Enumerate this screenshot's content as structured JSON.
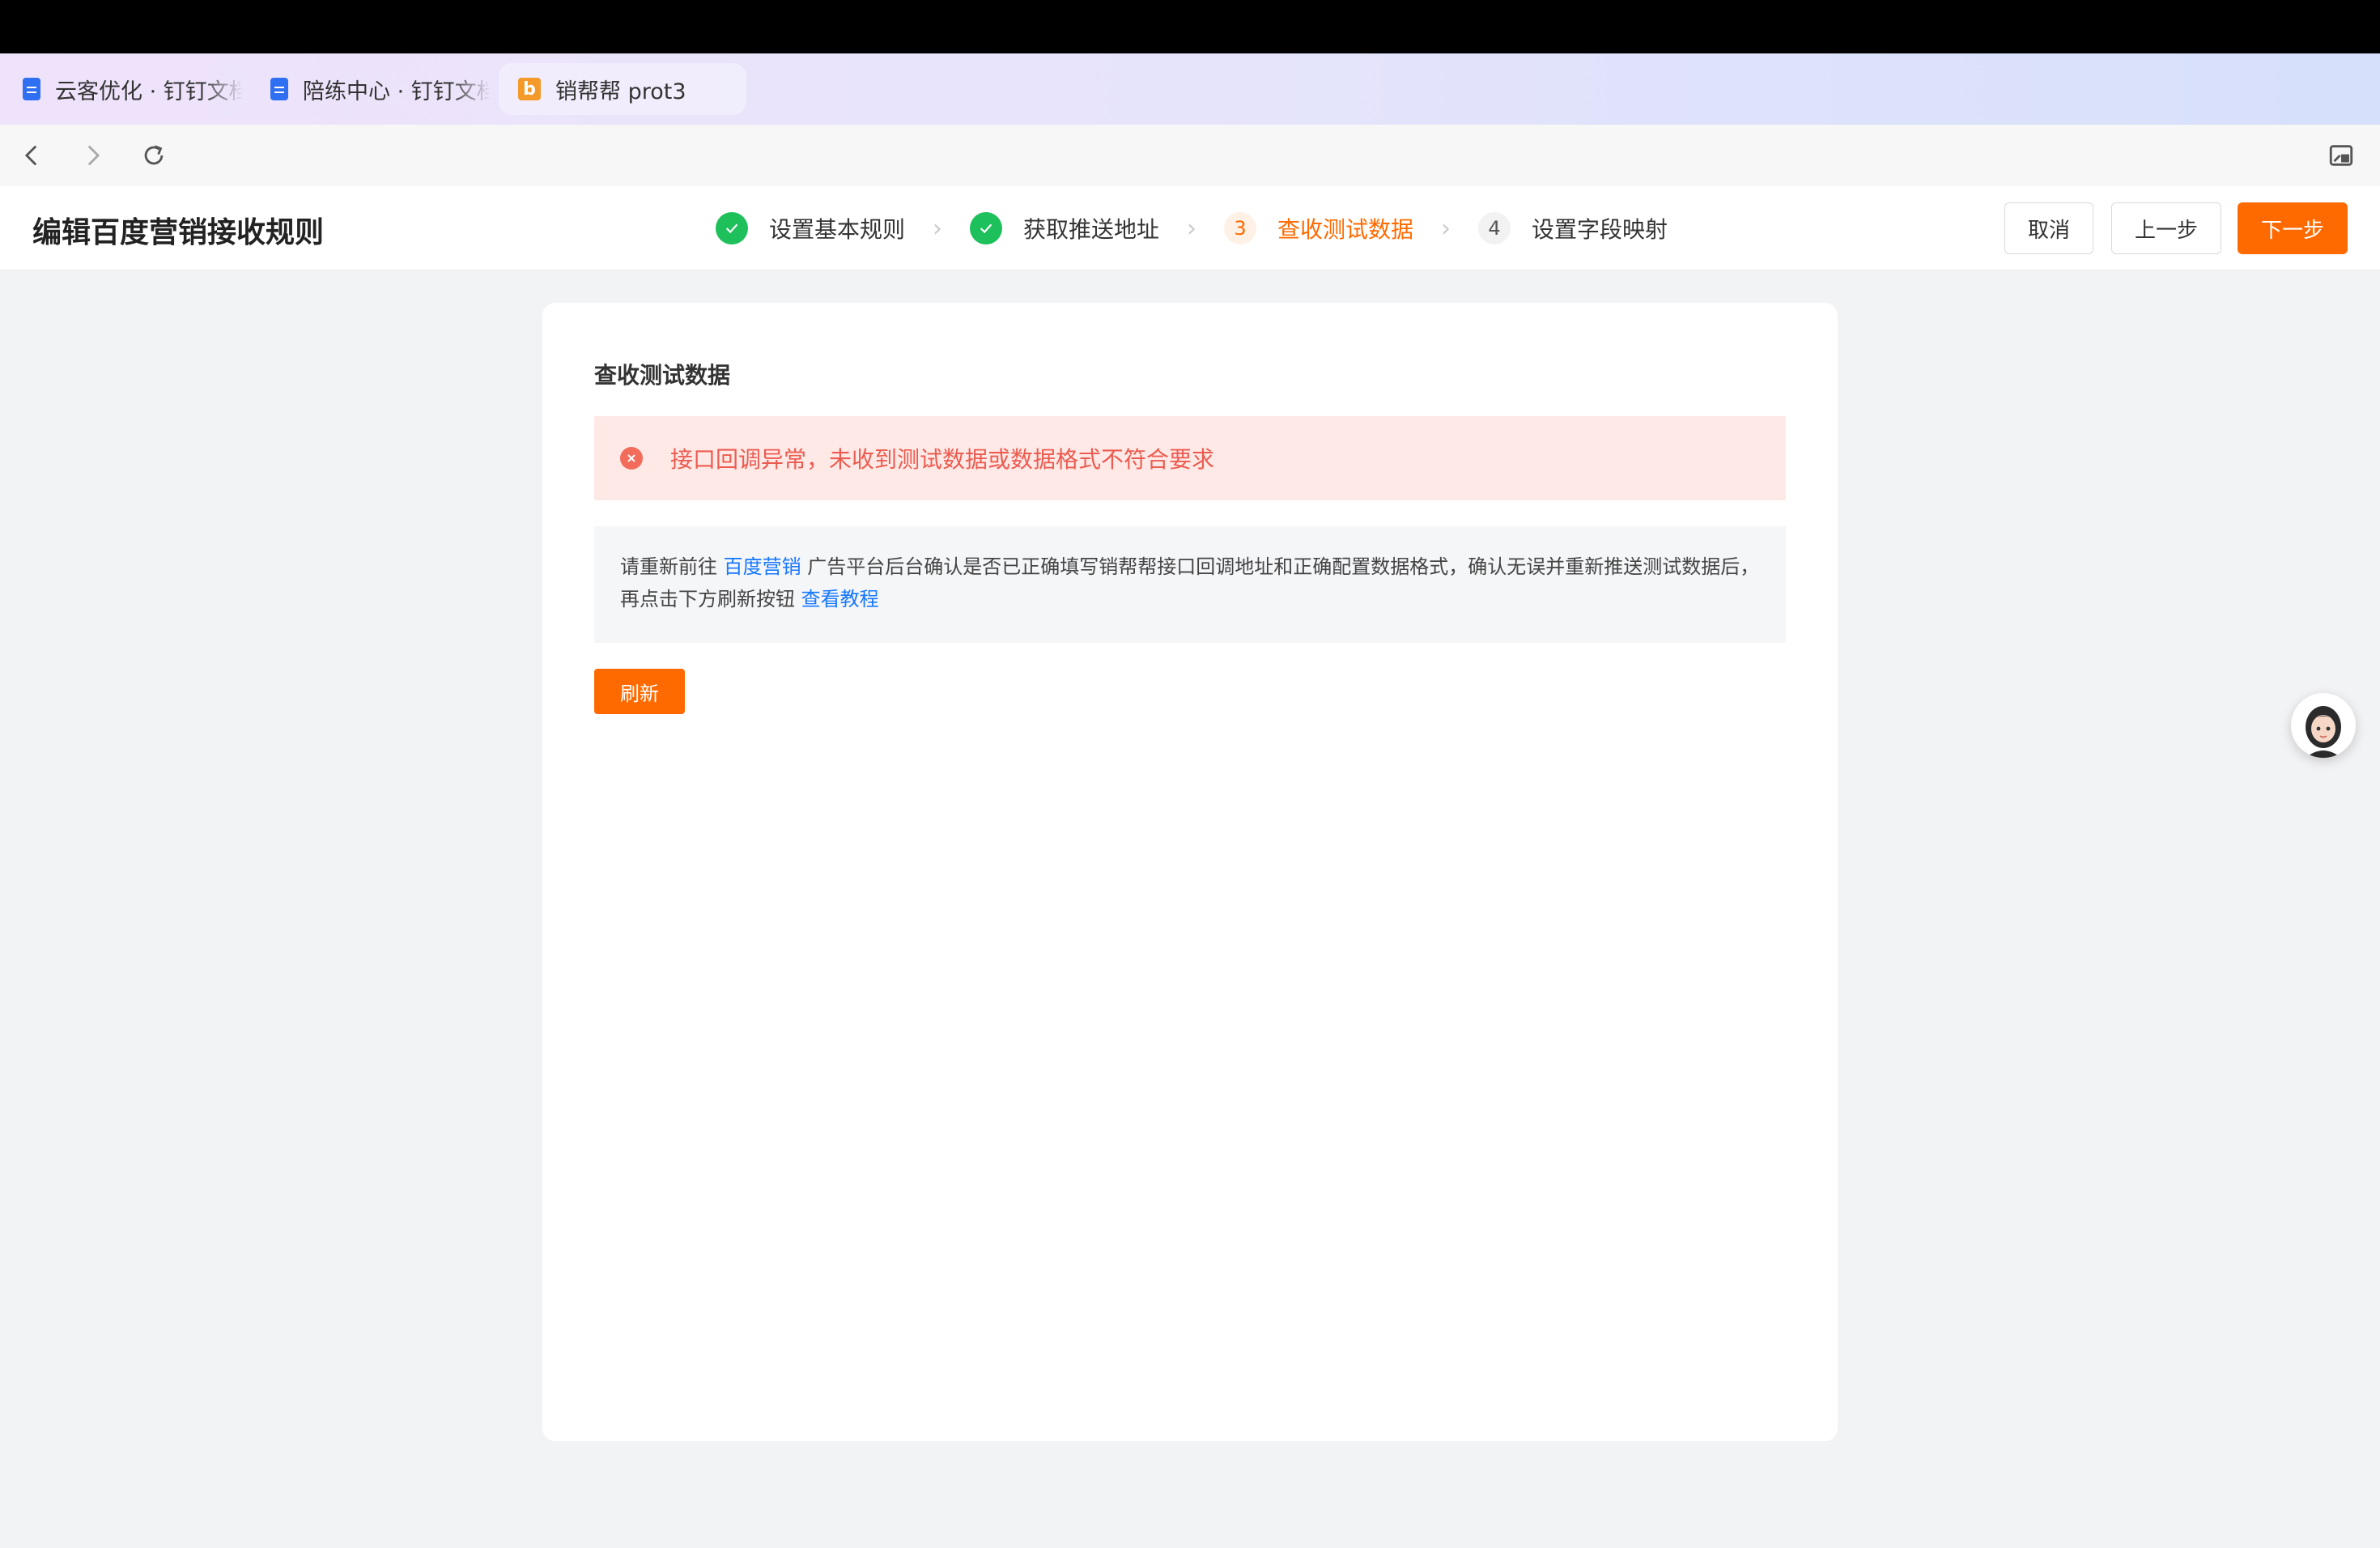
{
  "browser": {
    "tabs": [
      {
        "label": "云客优化 · 钉钉文档",
        "icon": "doc-icon",
        "active": false
      },
      {
        "label": "陪练中心 · 钉钉文档",
        "icon": "doc-icon",
        "active": false
      },
      {
        "label": "销帮帮 prot3",
        "icon": "xbb-logo-icon",
        "active": true
      }
    ],
    "logo_letter": "b"
  },
  "header": {
    "title": "编辑百度营销接收规则",
    "steps": [
      {
        "label": "设置基本规则",
        "status": "done",
        "index": ""
      },
      {
        "label": "获取推送地址",
        "status": "done",
        "index": ""
      },
      {
        "label": "查收测试数据",
        "status": "current",
        "index": "3"
      },
      {
        "label": "设置字段映射",
        "status": "todo",
        "index": "4"
      }
    ],
    "cancel_label": "取消",
    "prev_label": "上一步",
    "next_label": "下一步"
  },
  "main": {
    "card_title": "查收测试数据",
    "alert_text": "接口回调异常，未收到测试数据或数据格式不符合要求",
    "tip": {
      "prefix": "请重新前往 ",
      "link1": "百度营销",
      "middle": " 广告平台后台确认是否已正确填写销帮帮接口回调地址和正确配置数据格式，确认无误并重新推送测试数据后，",
      "line2": "再点击下方刷新按钮 ",
      "link2": "查看教程"
    },
    "refresh_label": "刷新"
  },
  "colors": {
    "accent": "#ff6a00",
    "success": "#1ec05b",
    "error": "#ec5b50",
    "link": "#1677ff"
  }
}
